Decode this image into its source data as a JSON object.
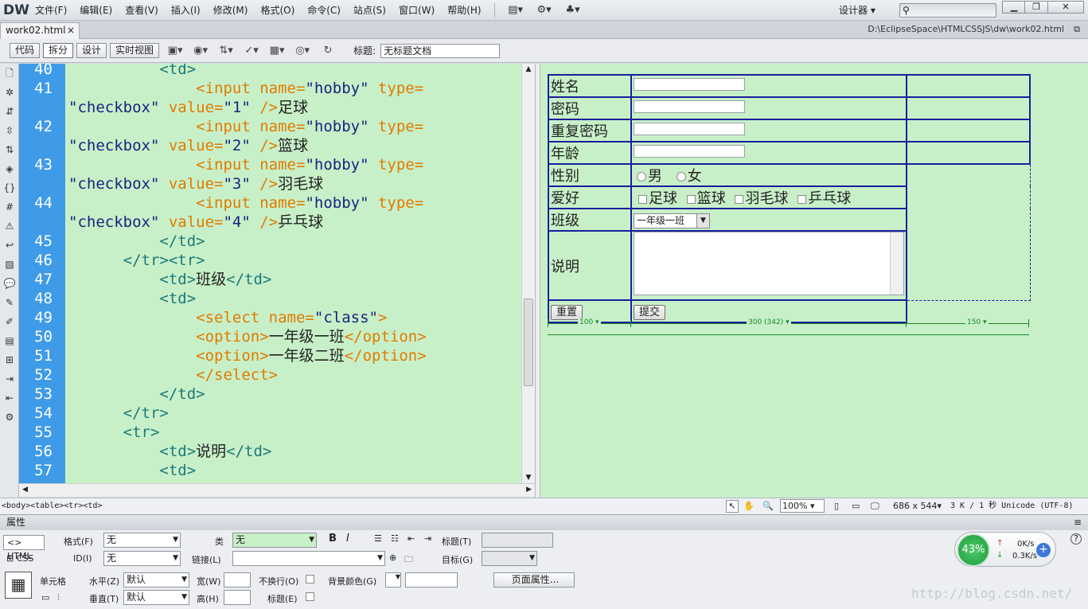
{
  "app": {
    "logo": "DW",
    "workspace": "设计器 ▾"
  },
  "menu": [
    "文件(F)",
    "编辑(E)",
    "查看(V)",
    "插入(I)",
    "修改(M)",
    "格式(O)",
    "命令(C)",
    "站点(S)",
    "窗口(W)",
    "帮助(H)"
  ],
  "search": {
    "placeholder": ""
  },
  "tab": {
    "name": "work02.html",
    "close": "×",
    "path": "D:\\EclipseSpace\\HTMLCSSJS\\dw\\work02.html"
  },
  "toolbar": {
    "code": "代码",
    "split": "拆分",
    "design": "设计",
    "live": "实时视图",
    "title_label": "标题:",
    "title_value": "无标题文档"
  },
  "code_lines": [
    {
      "n": "40",
      "parts": [
        [
          "tg",
          "          <td>"
        ]
      ]
    },
    {
      "n": "41",
      "parts": [
        [
          "tg",
          "              "
        ],
        [
          "tag",
          "<input "
        ],
        [
          "attr",
          "name="
        ],
        [
          "str",
          "\"hobby\""
        ],
        [
          "attr",
          " type="
        ]
      ]
    },
    {
      "n": "",
      "parts": [
        [
          "str",
          "\"checkbox\""
        ],
        [
          "attr",
          " value="
        ],
        [
          "str",
          "\"1\""
        ],
        [
          "tag",
          " />"
        ],
        [
          "txt",
          "足球"
        ]
      ]
    },
    {
      "n": "42",
      "parts": [
        [
          "tg",
          "              "
        ],
        [
          "tag",
          "<input "
        ],
        [
          "attr",
          "name="
        ],
        [
          "str",
          "\"hobby\""
        ],
        [
          "attr",
          " type="
        ]
      ]
    },
    {
      "n": "",
      "parts": [
        [
          "str",
          "\"checkbox\""
        ],
        [
          "attr",
          " value="
        ],
        [
          "str",
          "\"2\""
        ],
        [
          "tag",
          " />"
        ],
        [
          "txt",
          "篮球"
        ]
      ]
    },
    {
      "n": "43",
      "parts": [
        [
          "tg",
          "              "
        ],
        [
          "tag",
          "<input "
        ],
        [
          "attr",
          "name="
        ],
        [
          "str",
          "\"hobby\""
        ],
        [
          "attr",
          " type="
        ]
      ]
    },
    {
      "n": "",
      "parts": [
        [
          "str",
          "\"checkbox\""
        ],
        [
          "attr",
          " value="
        ],
        [
          "str",
          "\"3\""
        ],
        [
          "tag",
          " />"
        ],
        [
          "txt",
          "羽毛球"
        ]
      ]
    },
    {
      "n": "44",
      "parts": [
        [
          "tg",
          "              "
        ],
        [
          "tag",
          "<input "
        ],
        [
          "attr",
          "name="
        ],
        [
          "str",
          "\"hobby\""
        ],
        [
          "attr",
          " type="
        ]
      ]
    },
    {
      "n": "",
      "parts": [
        [
          "str",
          "\"checkbox\""
        ],
        [
          "attr",
          " value="
        ],
        [
          "str",
          "\"4\""
        ],
        [
          "tag",
          " />"
        ],
        [
          "txt",
          "乒乓球"
        ]
      ]
    },
    {
      "n": "45",
      "parts": [
        [
          "tg",
          "          </td>"
        ]
      ]
    },
    {
      "n": "46",
      "parts": [
        [
          "tg",
          "      </tr><tr>"
        ]
      ]
    },
    {
      "n": "47",
      "parts": [
        [
          "tg",
          "          <td>"
        ],
        [
          "txt",
          "班级"
        ],
        [
          "tg",
          "</td>"
        ]
      ]
    },
    {
      "n": "48",
      "parts": [
        [
          "tg",
          "          <td>"
        ]
      ]
    },
    {
      "n": "49",
      "parts": [
        [
          "tg",
          "              "
        ],
        [
          "tag",
          "<select "
        ],
        [
          "attr",
          "name="
        ],
        [
          "str",
          "\"class\""
        ],
        [
          "tag",
          ">"
        ]
      ]
    },
    {
      "n": "50",
      "parts": [
        [
          "tg",
          "              "
        ],
        [
          "tag",
          "<option>"
        ],
        [
          "txt",
          "一年级一班"
        ],
        [
          "tag",
          "</option>"
        ]
      ]
    },
    {
      "n": "51",
      "parts": [
        [
          "tg",
          "              "
        ],
        [
          "tag",
          "<option>"
        ],
        [
          "txt",
          "一年级二班"
        ],
        [
          "tag",
          "</option>"
        ]
      ]
    },
    {
      "n": "52",
      "parts": [
        [
          "tg",
          "              "
        ],
        [
          "tag",
          "</select>"
        ]
      ]
    },
    {
      "n": "53",
      "parts": [
        [
          "tg",
          "          </td>"
        ]
      ]
    },
    {
      "n": "54",
      "parts": [
        [
          "tg",
          "      </tr>"
        ]
      ]
    },
    {
      "n": "55",
      "parts": [
        [
          "tg",
          "      <tr>"
        ]
      ]
    },
    {
      "n": "56",
      "parts": [
        [
          "tg",
          "          <td>"
        ],
        [
          "txt",
          "说明"
        ],
        [
          "tg",
          "</td>"
        ]
      ]
    },
    {
      "n": "57",
      "parts": [
        [
          "tg",
          "          <td>"
        ]
      ]
    }
  ],
  "form": {
    "name": "姓名",
    "pwd": "密码",
    "pwd2": "重复密码",
    "age": "年龄",
    "gender": "性别",
    "male": "男",
    "female": "女",
    "hobby": "爱好",
    "h1": "足球",
    "h2": "篮球",
    "h3": "羽毛球",
    "h4": "乒乓球",
    "cls": "班级",
    "cls_value": "一年级一班",
    "desc": "说明",
    "reset": "重置",
    "submit": "提交"
  },
  "widths": {
    "c1": "100 ▾",
    "c2": "300 (342) ▾",
    "c3": "150 ▾"
  },
  "status": {
    "tags": "<body><table><tr><td>",
    "zoom": "100%",
    "size": "686 x 544▾",
    "info": "3 K / 1 秒 Unicode (UTF-8)"
  },
  "props": {
    "title": "属性",
    "html": "HTML",
    "css": "CSS",
    "format_label": "格式(F)",
    "format_val": "无",
    "class_label": "类",
    "class_val": "无",
    "id_label": "ID(I)",
    "id_val": "无",
    "link_label": "链接(L)",
    "title_label": "标题(T)",
    "target_label": "目标(G)",
    "cell": "单元格",
    "horz": "水平(Z)",
    "horz_val": "默认",
    "vert": "垂直(T)",
    "vert_val": "默认",
    "w": "宽(W)",
    "h": "高(H)",
    "nowrap": "不换行(O)",
    "header": "标题(E)",
    "bg": "背景颜色(G)",
    "page_props": "页面属性..."
  },
  "network": {
    "percent": "43%",
    "up": "0K/s",
    "down": "0.3K/s"
  },
  "watermark": "http://blog.csdn.net/"
}
